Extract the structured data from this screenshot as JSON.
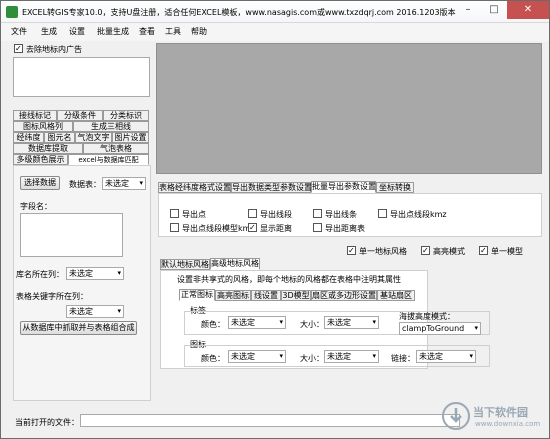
{
  "window": {
    "title": "EXCEL转GIS专家10.0，支持U盘注册，适合任何EXCEL模板，www.nasagis.com或www.txzdqrj.com 2016.1203版本"
  },
  "menu": {
    "items": [
      "文件",
      "生成",
      "设置",
      "批量生成",
      "查看",
      "工具",
      "帮助"
    ]
  },
  "left": {
    "remove_ads_label": "去除地标内广告",
    "tabs_row1": [
      "接线标记",
      "分级条件",
      "分类标识"
    ],
    "tabs_row2": [
      "图标风格列",
      "生成三相线"
    ],
    "tabs_row3": [
      "经纬度",
      "图元名",
      "气泡文字",
      "图片设置"
    ],
    "tabs_row4": [
      "数据库提取",
      "气泡表格"
    ],
    "tabs_row5": [
      "多级颜色展示",
      "excel与数据库匹配"
    ],
    "select_data_button": "选择数据",
    "table_label": "数据表：",
    "table_value": "未选定",
    "field_label": "字段名：",
    "county_col_label": "库名所在列：",
    "county_col_value": "未选定",
    "keyword_col_label": "表格关键字所在列：",
    "keyword_col_value": "未选定",
    "extract_button": "从数据库中抓取并与表格组合成"
  },
  "right": {
    "tabs": [
      "表格经纬度格式设置",
      "导出数据类型参数设置",
      "批量导出参数设置",
      "坐标转换"
    ],
    "active_tab": "批量导出参数设置",
    "export_options": [
      {
        "label": "导出点",
        "checked": false
      },
      {
        "label": "导出线段",
        "checked": false
      },
      {
        "label": "导出线条",
        "checked": false
      },
      {
        "label": "导出点线段kmz",
        "checked": false
      },
      {
        "label": "导出点线段模型kmz",
        "checked": false
      },
      {
        "label": "显示距离",
        "checked": true
      },
      {
        "label": "导出距离表",
        "checked": false
      }
    ],
    "options_row": [
      {
        "label": "单一地标风格",
        "checked": true
      },
      {
        "label": "高亮模式",
        "checked": true
      },
      {
        "label": "单一模型",
        "checked": true
      }
    ],
    "style_tabs": [
      "默认地标风格",
      "高级地标风格"
    ],
    "active_style_tab": "高级地标风格",
    "style_desc": "设置非共享式的风格，即每个地标的风格都在表格中注明其属性",
    "inner_tabs": [
      "正常图标",
      "高亮图标",
      "线设置",
      "3D模型",
      "扇区或多边形设置",
      "基站扇区"
    ],
    "active_inner_tab": "正常图标",
    "label_section": "标签",
    "color_label": "颜色：",
    "color_value": "未选定",
    "size_label": "大小：",
    "size_value": "未选定",
    "altitude_label": "海拔高度模式：",
    "altitude_value": "clampToGround",
    "icon_section": "图标",
    "icon_color_label": "颜色：",
    "icon_color_value": "未选定",
    "icon_size_label": "大小：",
    "icon_size_value": "未选定",
    "link_label": "链接：",
    "link_value": "未选定"
  },
  "status": {
    "current_file_label": "当前打开的文件："
  },
  "watermark": {
    "brand": "当下软件园",
    "url": "www.downxia.com"
  }
}
